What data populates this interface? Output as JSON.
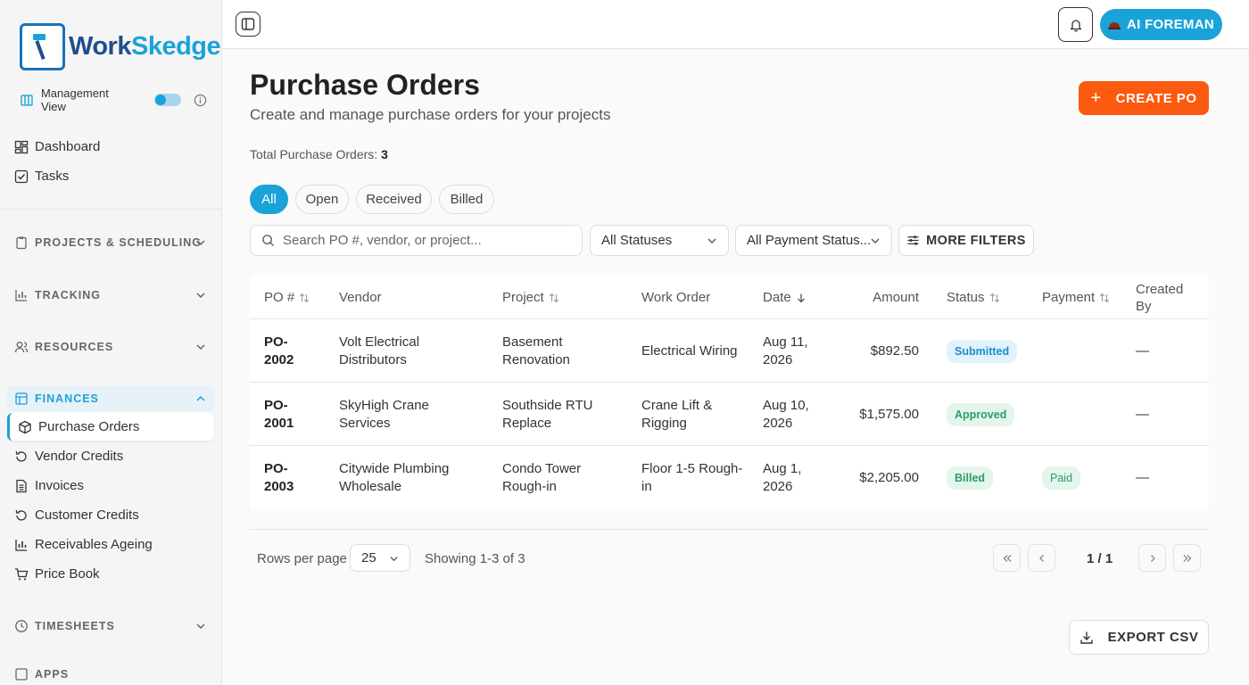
{
  "brand": {
    "name_part1": "Work",
    "name_part2": "Skedge"
  },
  "sidebar": {
    "management_view": "Management View",
    "items_top": [
      {
        "label": "Dashboard",
        "icon": "dashboard-icon"
      },
      {
        "label": "Tasks",
        "icon": "tasks-icon"
      }
    ],
    "sections": [
      {
        "label": "PROJECTS & SCHEDULING"
      },
      {
        "label": "TRACKING"
      },
      {
        "label": "RESOURCES"
      },
      {
        "label": "FINANCES"
      },
      {
        "label": "TIMESHEETS"
      },
      {
        "label": "APPS"
      }
    ],
    "finance_items": [
      {
        "label": "Purchase Orders",
        "active": true
      },
      {
        "label": "Vendor Credits"
      },
      {
        "label": "Invoices"
      },
      {
        "label": "Customer Credits"
      },
      {
        "label": "Receivables Ageing"
      },
      {
        "label": "Price Book"
      }
    ]
  },
  "topbar": {
    "ai_label": "AI FOREMAN"
  },
  "page": {
    "title": "Purchase Orders",
    "subtitle": "Create and manage purchase orders for your projects",
    "create_label": "CREATE PO",
    "total_label": "Total Purchase Orders:",
    "total_value": "3"
  },
  "tabs": [
    "All",
    "Open",
    "Received",
    "Billed"
  ],
  "filters": {
    "search_placeholder": "Search PO #, vendor, or project...",
    "status": "All Statuses",
    "payment": "All Payment Status...",
    "more": "MORE FILTERS"
  },
  "table": {
    "headers": [
      "PO #",
      "Vendor",
      "Project",
      "Work Order",
      "Date",
      "Amount",
      "Status",
      "Payment",
      "Created By"
    ],
    "rows": [
      {
        "po": "PO-2002",
        "vendor": "Volt Electrical Distributors",
        "project": "Basement Renovation",
        "work_order": "Electrical Wiring",
        "date": "Aug 11, 2026",
        "amount": "$892.50",
        "status": "Submitted",
        "payment": "",
        "created_by": "—"
      },
      {
        "po": "PO-2001",
        "vendor": "SkyHigh Crane Services",
        "project": "Southside RTU Replace",
        "work_order": "Crane Lift & Rigging",
        "date": "Aug 10, 2026",
        "amount": "$1,575.00",
        "status": "Approved",
        "payment": "",
        "created_by": "—"
      },
      {
        "po": "PO-2003",
        "vendor": "Citywide Plumbing Wholesale",
        "project": "Condo Tower Rough-in",
        "work_order": "Floor 1-5 Rough-in",
        "date": "Aug 1, 2026",
        "amount": "$2,205.00",
        "status": "Billed",
        "payment": "Paid",
        "created_by": "—"
      }
    ]
  },
  "pagination": {
    "rows_per_page_label": "Rows per page",
    "rows_per_page": "25",
    "showing": "Showing 1-3 of 3",
    "page": "1 / 1"
  },
  "export_label": "EXPORT CSV",
  "colors": {
    "accent": "#1aa3d8",
    "primary_action": "#fb5a10"
  }
}
